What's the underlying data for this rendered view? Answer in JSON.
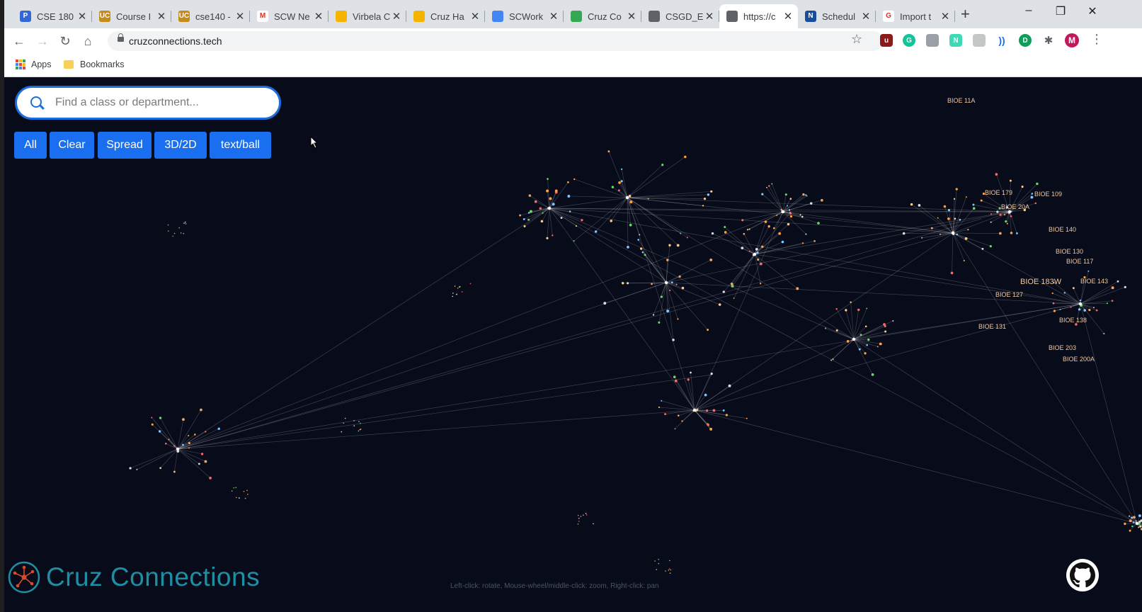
{
  "browser": {
    "tabs": [
      {
        "label": "CSE 180",
        "favicon": "p-logo-icon",
        "color": "#3367d6",
        "glyph": "P"
      },
      {
        "label": "Course I",
        "favicon": "ucsc-logo-icon",
        "color": "#c78a17",
        "glyph": "UC"
      },
      {
        "label": "cse140 -",
        "favicon": "ucsc-logo-icon",
        "color": "#c78a17",
        "glyph": "UC"
      },
      {
        "label": "SCW Ne",
        "favicon": "gmail-icon",
        "color": "#ffffff",
        "glyph": "M"
      },
      {
        "label": "Virbela C",
        "favicon": "slides-icon",
        "color": "#f4b400",
        "glyph": ""
      },
      {
        "label": "Cruz Ha",
        "favicon": "slides-icon",
        "color": "#f4b400",
        "glyph": ""
      },
      {
        "label": "SCWork",
        "favicon": "docs-icon",
        "color": "#4285f4",
        "glyph": ""
      },
      {
        "label": "Cruz Co",
        "favicon": "drive-icon",
        "color": "#34a853",
        "glyph": ""
      },
      {
        "label": "CSGD_E",
        "favicon": "globe-icon",
        "color": "#5f6368",
        "glyph": ""
      },
      {
        "label": "https://c",
        "favicon": "globe-icon",
        "color": "#5f6368",
        "glyph": "",
        "active": true
      },
      {
        "label": "Schedul",
        "favicon": "n-logo-icon",
        "color": "#1a4c9c",
        "glyph": "N"
      },
      {
        "label": "Import t",
        "favicon": "google-icon",
        "color": "#ffffff",
        "glyph": "G"
      }
    ],
    "url": "cruzconnections.tech",
    "bookmarks": {
      "apps": "Apps",
      "folder": "Bookmarks"
    },
    "profile_initial": "M"
  },
  "app": {
    "search_placeholder": "Find a class or department...",
    "buttons": [
      "All",
      "Clear",
      "Spread",
      "3D/2D",
      "text/ball"
    ],
    "brand": "Cruz Connections",
    "hint": "Left-click: rotate, Mouse-wheel/middle-click: zoom, Right-click: pan",
    "colors": {
      "accent": "#1a6ff0",
      "brand": "#1e8fa3",
      "background": "#070b1a"
    }
  },
  "graph_labels": [
    "BIOE 109",
    "BIOE 20A",
    "BIOE 140",
    "BIOE 117",
    "BIOE 183W",
    "BIOE 143",
    "BIOE 138",
    "BIOE 203",
    "BIOE 200A",
    "BIOE 131",
    "BIOE 179",
    "BIOE 11A",
    "BIOE 127",
    "BIOE 130"
  ]
}
